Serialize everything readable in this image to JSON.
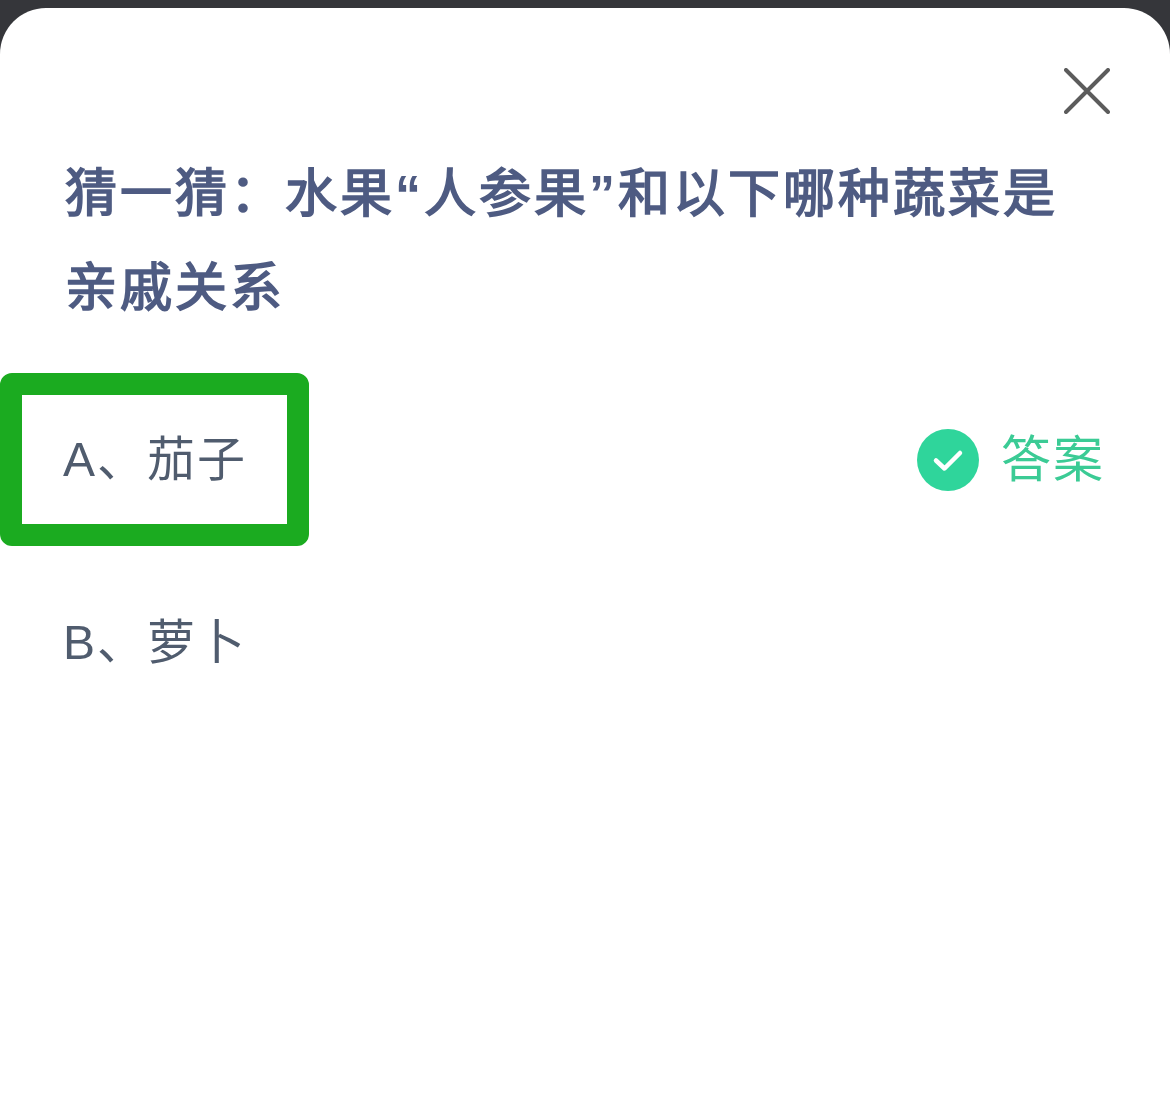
{
  "question": {
    "title": "猜一猜：水果“人参果”和以下哪种蔬菜是亲戚关系"
  },
  "options": [
    {
      "label": "A、茄子",
      "highlighted": true,
      "answer": true,
      "answer_label": "答案"
    },
    {
      "label": "B、萝卜",
      "highlighted": false,
      "answer": false
    }
  ]
}
